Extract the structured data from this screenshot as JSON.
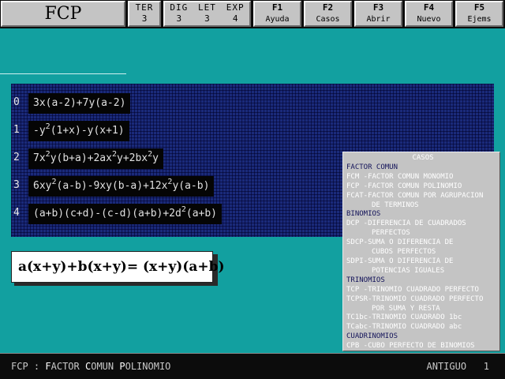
{
  "header": {
    "logo": "FCP",
    "ter": {
      "label": "TER",
      "value": "3"
    },
    "stats": [
      {
        "label": "DIG",
        "value": "3"
      },
      {
        "label": "LET",
        "value": "3"
      },
      {
        "label": "EXP",
        "value": "4"
      }
    ],
    "fkeys": [
      {
        "key": "F1",
        "label": "Ayuda"
      },
      {
        "key": "F2",
        "label": "Casos"
      },
      {
        "key": "F3",
        "label": "Abrir"
      },
      {
        "key": "F4",
        "label": "Nuevo"
      },
      {
        "key": "F5",
        "label": "Ejems"
      }
    ]
  },
  "expressions": [
    {
      "index": "0",
      "parts": [
        "3x(a-2)+7y(a-2)"
      ]
    },
    {
      "index": "1",
      "parts": [
        "-y",
        "2",
        "(1+x)-y(x+1)"
      ]
    },
    {
      "index": "2",
      "parts": [
        "7x",
        "2",
        "y(b+a)+2ax",
        "2",
        "y+2bx",
        "2",
        "y"
      ]
    },
    {
      "index": "3",
      "parts": [
        "6xy",
        "2",
        "(a-b)-9xy(b-a)+12x",
        "2",
        "y(a-b)"
      ]
    },
    {
      "index": "4",
      "parts": [
        "(a+b)(c+d)-(c-d)(a+b)+2d",
        "2",
        "(a+b)"
      ]
    }
  ],
  "result": "a(x+y)+b(x+y)= (x+y)(a+b)",
  "cases": {
    "title": "CASOS",
    "lines": [
      {
        "text": "FACTOR COMUN",
        "type": "hdr"
      },
      {
        "text": "FCM -FACTOR COMUN MONOMIO",
        "type": "item"
      },
      {
        "text": "FCP -FACTOR COMUN POLINOMIO",
        "type": "item"
      },
      {
        "text": "FCAT-FACTOR COMUN POR AGRUPACION",
        "type": "item"
      },
      {
        "text": "DE TERMINOS",
        "type": "indent"
      },
      {
        "text": "BINOMIOS",
        "type": "hdr"
      },
      {
        "text": "DCP -DIFERENCIA DE CUADRADOS",
        "type": "item"
      },
      {
        "text": "PERFECTOS",
        "type": "indent"
      },
      {
        "text": "SDCP-SUMA O DIFERENCIA DE",
        "type": "item"
      },
      {
        "text": "CUBOS PERFECTOS",
        "type": "indent"
      },
      {
        "text": "SDPI-SUMA O DIFERENCIA DE",
        "type": "item"
      },
      {
        "text": "POTENCIAS IGUALES",
        "type": "indent"
      },
      {
        "text": "TRINOMIOS",
        "type": "hdr"
      },
      {
        "text": "TCP  -TRINOMIO CUADRADO PERFECTO",
        "type": "item"
      },
      {
        "text": "TCPSR-TRINOMIO CUADRADO PERFECTO",
        "type": "item"
      },
      {
        "text": "POR SUMA Y RESTA",
        "type": "indent"
      },
      {
        "text": "TC1bc-TRINOMIO CUADRADO 1bc",
        "type": "item"
      },
      {
        "text": "TCabc-TRINOMIO CUADRADO abc",
        "type": "item"
      },
      {
        "text": "CUADRINOMIOS",
        "type": "hdr"
      },
      {
        "text": "CPB  -CUBO PERFECTO DE BINOMIOS",
        "type": "item"
      }
    ]
  },
  "status": {
    "code": "FCP",
    "separator": ":",
    "words": [
      "FACTOR",
      "COMUN",
      "POLINOMIO"
    ],
    "right_label": "ANTIGUO",
    "right_value": "1"
  }
}
